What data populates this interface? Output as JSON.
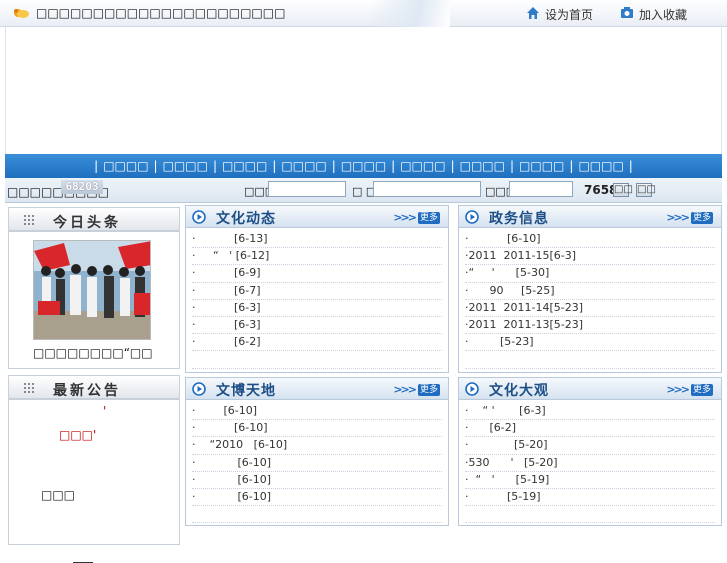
{
  "top": {
    "title": "□□□□□□□□□□□□□□□□□□□□□□",
    "set_home": "设为首页",
    "add_favorite": "加入收藏"
  },
  "nav": {
    "items": [
      "□□□□",
      "□□□□",
      "□□□□",
      "□□□□",
      "□□□□",
      "□□□□",
      "□□□□",
      "□□□□",
      "□□□□"
    ]
  },
  "search": {
    "visits_label": "□□□□□□□□□",
    "visits_count": "68203",
    "label_1": "□□□",
    "label_2": "□ □",
    "label_3": "□□□",
    "input_1": "",
    "input_2": "",
    "input_3": "",
    "code": "7658",
    "btn_1": "□□",
    "btn_2": "□□"
  },
  "sidebar": {
    "headline": {
      "title": "今日头条",
      "caption": "□□□□□□□□“□□"
    },
    "notice": {
      "title": "最新公告",
      "red_text": "□□□'",
      "red_mark": "'",
      "body": "□□□"
    }
  },
  "panels": [
    {
      "title": "文化动态",
      "more": "更多",
      "rows": [
        "·           [6-13]",
        "·     “   ' [6-12]",
        "·           [6-9]",
        "·           [6-7]",
        "·           [6-3]",
        "·           [6-3]",
        "·           [6-2]",
        ""
      ]
    },
    {
      "title": "政务信息",
      "more": "更多",
      "rows": [
        "·           [6-10]",
        "·2011  2011-15[6-3]",
        "·“     '      [5-30]",
        "·      90     [5-25]",
        "·2011  2011-14[5-23]",
        "·2011  2011-13[5-23]",
        "·         [5-23]",
        ""
      ]
    },
    {
      "title": "文博天地",
      "more": "更多",
      "rows": [
        "·        [6-10]",
        "·           [6-10]",
        "·    “2010   [6-10]",
        "·            [6-10]",
        "·            [6-10]",
        "·            [6-10]",
        ""
      ]
    },
    {
      "title": "文化大观",
      "more": "更多",
      "rows": [
        "·    “ '       [6-3]",
        "·      [6-2]",
        "·             [5-20]",
        "·530      '   [5-20]",
        "·  “   '      [5-19]",
        "·           [5-19]",
        ""
      ]
    }
  ],
  "colors": {
    "nav_blue": "#1e6fbf",
    "panel_title": "#1d4f86",
    "notice_red": "#c40000"
  }
}
